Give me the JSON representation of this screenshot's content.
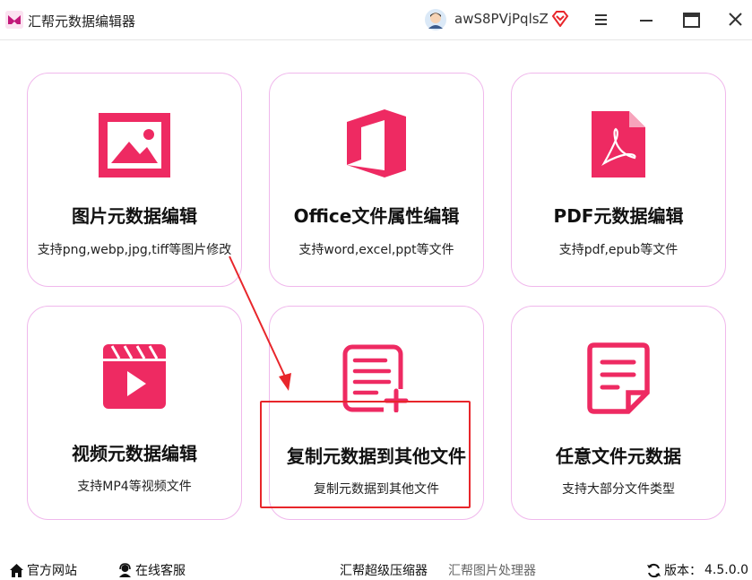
{
  "window": {
    "title": "汇帮元数据编辑器",
    "username": "awS8PVjPqlsZ"
  },
  "cards": [
    {
      "title": "图片元数据编辑",
      "desc": "支持png,webp,jpg,tiff等图片修改"
    },
    {
      "title": "Office文件属性编辑",
      "desc": "支持word,excel,ppt等文件"
    },
    {
      "title": "PDF元数据编辑",
      "desc": "支持pdf,epub等文件"
    },
    {
      "title": "视频元数据编辑",
      "desc": "支持MP4等视频文件"
    },
    {
      "title": "复制元数据到其他文件",
      "desc": "复制元数据到其他文件"
    },
    {
      "title": "任意文件元数据",
      "desc": "支持大部分文件类型"
    }
  ],
  "statusbar": {
    "website": "官方网站",
    "support": "在线客服",
    "compressor": "汇帮超级压缩器",
    "image_tool": "汇帮图片处理器",
    "version_label": "版本：",
    "version": "4.5.0.0"
  },
  "colors": {
    "accent": "#ee2a62",
    "card_border": "#f0b8ec",
    "highlight": "#e8262b"
  },
  "icons": [
    "app-logo-icon",
    "user-avatar-icon",
    "vip-diamond-icon",
    "menu-icon",
    "minimize-icon",
    "maximize-icon",
    "close-icon",
    "image-icon",
    "office-icon",
    "pdf-icon",
    "video-clapper-icon",
    "copy-document-icon",
    "file-document-icon",
    "home-icon",
    "headset-icon",
    "refresh-icon"
  ]
}
